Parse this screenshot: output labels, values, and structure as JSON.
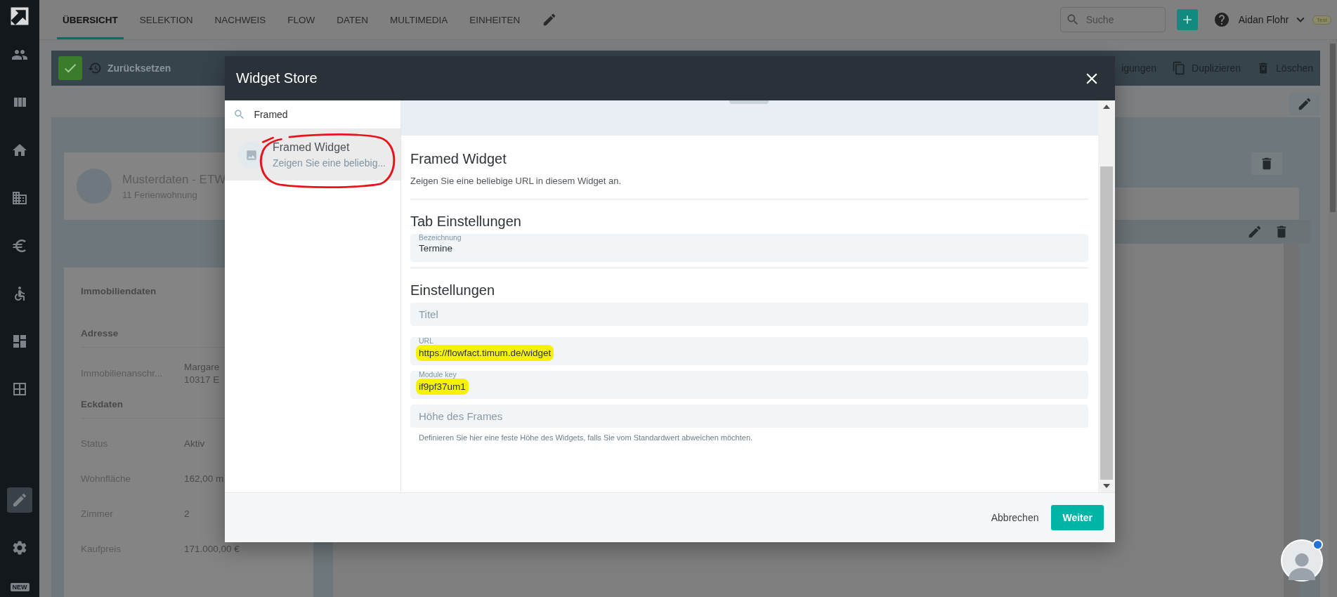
{
  "sidebar": {
    "items": [
      {
        "selected": false
      },
      {
        "selected": false
      },
      {
        "selected": false
      },
      {
        "selected": false
      },
      {
        "selected": false
      },
      {
        "selected": false
      },
      {
        "selected": false
      },
      {
        "selected": false
      }
    ],
    "bottom_items": [
      {
        "selected": true
      },
      {
        "selected": false
      }
    ],
    "new_badge": "NEW"
  },
  "app_bar": {
    "tabs": [
      {
        "label": "ÜBERSICHT",
        "selected": true
      },
      {
        "label": "SELEKTION",
        "selected": false
      },
      {
        "label": "NACHWEIS",
        "selected": false
      },
      {
        "label": "FLOW",
        "selected": false
      },
      {
        "label": "DATEN",
        "selected": false
      },
      {
        "label": "MULTIMEDIA",
        "selected": false
      },
      {
        "label": "EINHEITEN",
        "selected": false
      }
    ],
    "search": {
      "placeholder": "Suche"
    },
    "user": {
      "name": "Aidan Flohr",
      "badge": "Test"
    }
  },
  "action_bar": {
    "reset": "Zurücksetzen",
    "actions": [
      {
        "kind": "link",
        "label": "igungen"
      },
      {
        "kind": "copy",
        "label": "Duplizieren"
      },
      {
        "kind": "delete",
        "label": "Löschen"
      }
    ]
  },
  "profile": {
    "title": "Musterdaten - ETW",
    "subtitle": "11 Ferienwohnung"
  },
  "details": {
    "heading": "Immobiliendaten",
    "sections": [
      {
        "title": "Adresse",
        "rows": [
          {
            "label": "Immobilienanschr...",
            "value": [
              "Margare",
              "10317  E"
            ]
          }
        ]
      },
      {
        "title": "Eckdaten",
        "rows": [
          {
            "label": "Status",
            "value": [
              "Aktiv"
            ]
          },
          {
            "label": "Wohnfläche",
            "value": [
              "162,00 m"
            ]
          },
          {
            "label": "Zimmer",
            "value": [
              "2"
            ]
          },
          {
            "label": "Kaufpreis",
            "value": [
              "171.000,00 €"
            ]
          }
        ]
      }
    ]
  },
  "modal": {
    "title": "Widget Store",
    "search": {
      "value": "Framed"
    },
    "results": [
      {
        "title": "Framed Widget",
        "subtitle": "Zeigen Sie eine beliebig...",
        "selected": true
      }
    ],
    "detail": {
      "title": "Framed Widget",
      "description": "Zeigen Sie eine beliebige URL in diesem Widget an.",
      "groups": [
        {
          "title": "Tab Einstellungen",
          "fields": [
            {
              "label": "Bezeichnung",
              "value": "Termine",
              "highlighted": false
            }
          ]
        },
        {
          "title": "Einstellungen",
          "fields": [
            {
              "placeholder": "Titel"
            },
            {
              "label": "URL",
              "value": "https://flowfact.timum.de/widget",
              "highlighted": true
            },
            {
              "label": "Module key",
              "value": "if9pf37um1",
              "highlighted": true
            },
            {
              "placeholder": "Höhe des Frames",
              "hint": "Definieren Sie hier eine feste Höhe des Widgets, falls Sie vom Standardwert abweichen möchten."
            }
          ]
        }
      ]
    },
    "cancel": "Abbrechen",
    "next": "Weiter"
  }
}
